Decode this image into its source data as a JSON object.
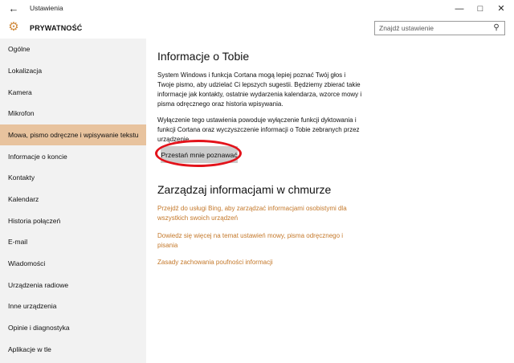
{
  "window": {
    "title": "Ustawienia",
    "back_icon": "←",
    "minimize_icon": "—",
    "maximize_icon": "□",
    "close_icon": "✕"
  },
  "header": {
    "gear_icon": "⚙",
    "section": "PRYWATNOŚĆ",
    "search_placeholder": "Znajdź ustawienie",
    "search_icon": "⚲"
  },
  "sidebar": {
    "selected_index": 4,
    "items": [
      {
        "label": "Ogólne"
      },
      {
        "label": "Lokalizacja"
      },
      {
        "label": "Kamera"
      },
      {
        "label": "Mikrofon"
      },
      {
        "label": "Mowa, pismo odręczne i wpisywanie tekstu"
      },
      {
        "label": "Informacje o koncie"
      },
      {
        "label": "Kontakty"
      },
      {
        "label": "Kalendarz"
      },
      {
        "label": "Historia połączeń"
      },
      {
        "label": "E-mail"
      },
      {
        "label": "Wiadomości"
      },
      {
        "label": "Urządzenia radiowe"
      },
      {
        "label": "Inne urządzenia"
      },
      {
        "label": "Opinie i diagnostyka"
      },
      {
        "label": "Aplikacje w tle"
      }
    ]
  },
  "main": {
    "heading": "Informacje o Tobie",
    "paragraph1": "System Windows i funkcja Cortana mogą lepiej poznać Twój głos i Twoje pismo, aby udzielać Ci lepszych sugestii. Będziemy zbierać takie informacje jak kontakty, ostatnie wydarzenia kalendarza, wzorce mowy i pisma odręcznego oraz historia wpisywania.",
    "paragraph2": "Wyłączenie tego ustawienia powoduje wyłączenie funkcji dyktowania i funkcji Cortana oraz wyczyszczenie informacji o Tobie zebranych przez urządzenie.",
    "stop_button": "Przestań mnie poznawać",
    "cloud_heading": "Zarządzaj informacjami w chmurze",
    "links": [
      "Przejdź do usługi Bing, aby zarządzać informacjami osobistymi dla wszystkich swoich urządzeń",
      "Dowiedz się więcej na temat ustawień mowy, pisma odręcznego i pisania",
      "Zasady zachowania poufności informacji"
    ]
  },
  "colors": {
    "accent": "#d08a3c",
    "selected_bg": "#e8c39e",
    "link": "#c4782a",
    "highlight_circle": "#e3131b"
  }
}
